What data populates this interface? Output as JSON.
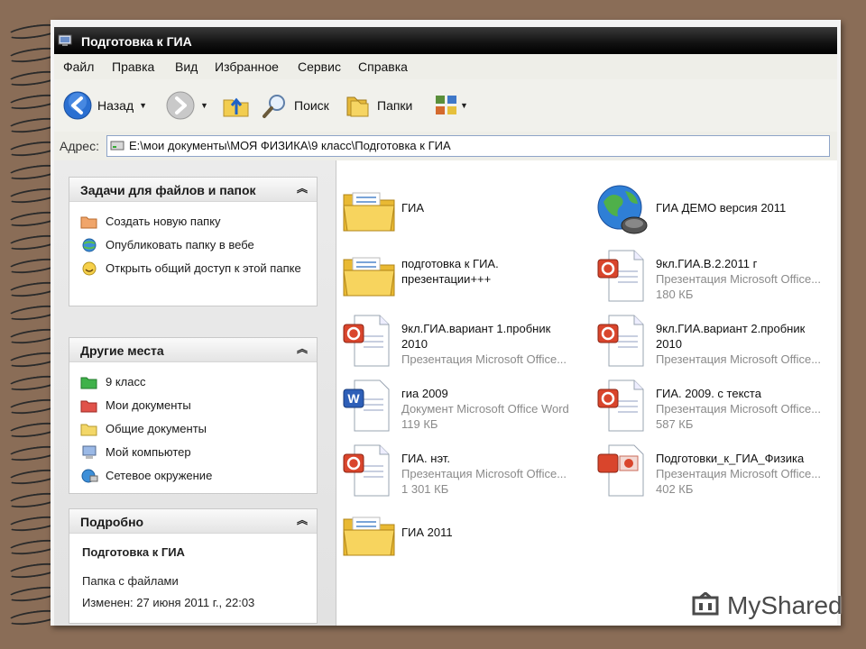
{
  "window": {
    "title": "Подготовка к ГИА"
  },
  "menu": [
    "Файл",
    "Правка",
    "Вид",
    "Избранное",
    "Сервис",
    "Справка"
  ],
  "toolbar": {
    "back": "Назад",
    "search": "Поиск",
    "folders": "Папки"
  },
  "address": {
    "label": "Адрес:",
    "path": "E:\\мои документы\\МОЯ ФИЗИКА\\9 класс\\Подготовка к ГИА"
  },
  "tasks": {
    "title": "Задачи для файлов и папок",
    "items": [
      {
        "label": "Создать новую папку",
        "icon": "new-folder-icon"
      },
      {
        "label": "Опубликовать папку в вебе",
        "icon": "publish-web-icon"
      },
      {
        "label": "Открыть общий доступ к этой папке",
        "icon": "share-icon"
      }
    ]
  },
  "places": {
    "title": "Другие места",
    "items": [
      {
        "label": "9 класс",
        "icon": "green-folder-icon"
      },
      {
        "label": "Мои документы",
        "icon": "my-documents-icon"
      },
      {
        "label": "Общие документы",
        "icon": "shared-documents-icon"
      },
      {
        "label": "Мой компьютер",
        "icon": "my-computer-icon"
      },
      {
        "label": "Сетевое окружение",
        "icon": "network-icon"
      }
    ]
  },
  "details": {
    "title": "Подробно",
    "name": "Подготовка к ГИА",
    "type": "Папка с файлами",
    "modified": "Изменен: 27 июня 2011 г., 22:03"
  },
  "files": [
    {
      "name": "ГИА",
      "line2": "",
      "line3": "",
      "kind": "folder"
    },
    {
      "name": "ГИА ДЕМО версия 2011",
      "line2": "",
      "line3": "",
      "kind": "globe"
    },
    {
      "name": "подготовка к ГИА.",
      "line2": "презентации+++",
      "line3": "",
      "kind": "folder",
      "line2_plain": true
    },
    {
      "name": "9кл.ГИА.В.2.2011 г",
      "line2": "Презентация Microsoft Office...",
      "line3": "180 КБ",
      "kind": "ppt"
    },
    {
      "name": "9кл.ГИА.вариант 1.пробник",
      "line2": "2010",
      "line3": "Презентация Microsoft Office...",
      "kind": "ppt",
      "line2_plain": true
    },
    {
      "name": "9кл.ГИА.вариант 2.пробник",
      "line2": "2010",
      "line3": "Презентация Microsoft Office...",
      "kind": "ppt",
      "line2_plain": true
    },
    {
      "name": "гиа 2009",
      "line2": "Документ Microsoft Office Word",
      "line3": "119 КБ",
      "kind": "word"
    },
    {
      "name": "ГИА. 2009. с текста",
      "line2": "Презентация Microsoft Office...",
      "line3": "587 КБ",
      "kind": "ppt"
    },
    {
      "name": "ГИА. нэт.",
      "line2": "Презентация Microsoft Office...",
      "line3": "1 301 КБ",
      "kind": "ppt"
    },
    {
      "name": "Подготовки_к_ГИА_Физика",
      "line2": "Презентация Microsoft Office...",
      "line3": "402 КБ",
      "kind": "pps"
    },
    {
      "name": "ГИА 2011",
      "line2": "",
      "line3": "",
      "kind": "folder"
    }
  ],
  "watermark": "MyShared"
}
